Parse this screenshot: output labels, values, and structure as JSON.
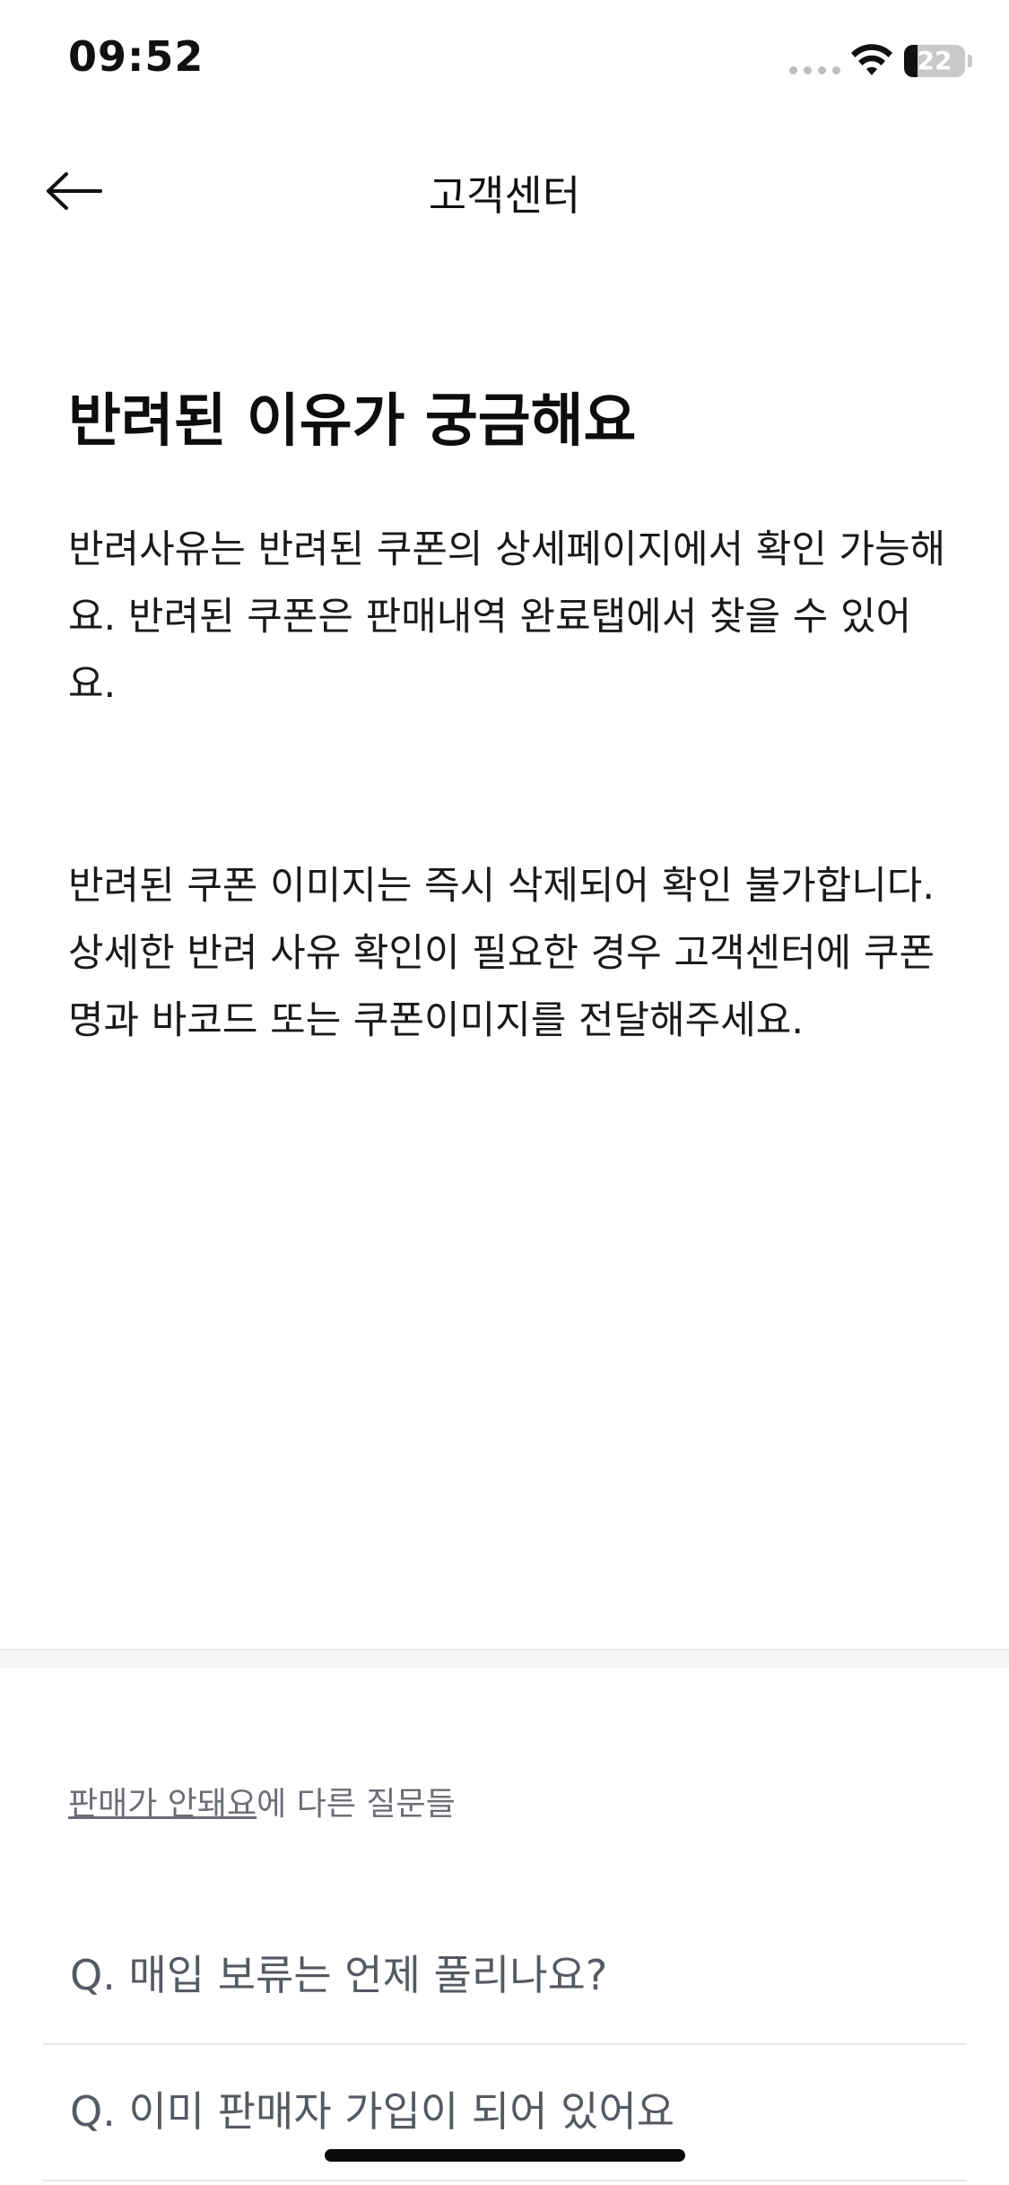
{
  "status_bar": {
    "time": "09:52",
    "battery_percent": "22",
    "battery_level": 0.22,
    "icons": [
      "signal-dots-icon",
      "wifi-icon",
      "battery-icon"
    ]
  },
  "nav": {
    "title": "고객센터",
    "back_icon": "arrow-left-icon"
  },
  "article": {
    "title": "반려된 이유가 궁금해요",
    "paragraphs": [
      "반려사유는 반려된 쿠폰의 상세페이지에서 확인 가능해요. 반려된 쿠폰은 판매내역 완료탭에서 찾을 수 있어요.",
      "반려된 쿠폰 이미지는 즉시 삭제되어 확인 불가합니다. 상세한 반려 사유 확인이 필요한 경우 고객센터에 쿠폰명과 바코드 또는 쿠폰이미지를 전달해주세요."
    ]
  },
  "related": {
    "category_link": "판매가 안돼요",
    "suffix": "에 다른 질문들",
    "questions": [
      "Q. 매입 보류는 언제 풀리나요?",
      "Q. 이미 판매자 가입이 되어 있어요"
    ]
  },
  "colors": {
    "background": "#ffffff",
    "text_primary": "#111111",
    "text_secondary": "#6b6e75",
    "divider": "#f5f6f8"
  }
}
